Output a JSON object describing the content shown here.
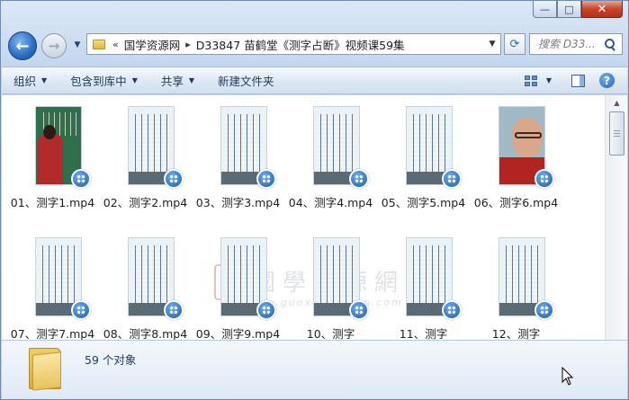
{
  "window": {
    "caption_buttons": {
      "minimize": "—",
      "maximize": "□",
      "close": "✕"
    }
  },
  "nav": {
    "back_icon": "arrow-left-icon",
    "forward_icon": "arrow-right-icon",
    "back_glyph": "←",
    "forward_glyph": "→",
    "history_glyph": "▼"
  },
  "address": {
    "overflow": "«",
    "crumbs": [
      "国学资源网",
      "D33847 苗鹤堂《测字占断》视频课59集"
    ],
    "separator": "▸",
    "dropdown_glyph": "▼",
    "refresh_glyph": "⟳"
  },
  "search": {
    "placeholder": "搜索 D33..."
  },
  "toolbar": {
    "items": [
      "组织",
      "包含到库中",
      "共享",
      "新建文件夹"
    ],
    "dropdown_glyph": "▼",
    "help_glyph": "?"
  },
  "files": [
    {
      "name": "01、测字1.mp4",
      "thumb": "board"
    },
    {
      "name": "02、测字2.mp4",
      "thumb": "doc"
    },
    {
      "name": "03、测字3.mp4",
      "thumb": "doc"
    },
    {
      "name": "04、测字4.mp4",
      "thumb": "doc"
    },
    {
      "name": "05、测字5.mp4",
      "thumb": "doc"
    },
    {
      "name": "06、测字6.mp4",
      "thumb": "face"
    },
    {
      "name": "07、测字7.mp4",
      "thumb": "doc"
    },
    {
      "name": "08、测字8.mp4",
      "thumb": "doc"
    },
    {
      "name": "09、测字9.mp4",
      "thumb": "doc"
    },
    {
      "name": "10、测字",
      "thumb": "doc"
    },
    {
      "name": "11、测字",
      "thumb": "doc"
    },
    {
      "name": "12、测字",
      "thumb": "doc"
    }
  ],
  "watermark": {
    "seal": "德",
    "title": "國學資源網",
    "url": "www.guoxueziyuan.com"
  },
  "status": {
    "count": "59 个对象"
  },
  "scrollbar": {
    "up_glyph": "▲"
  }
}
